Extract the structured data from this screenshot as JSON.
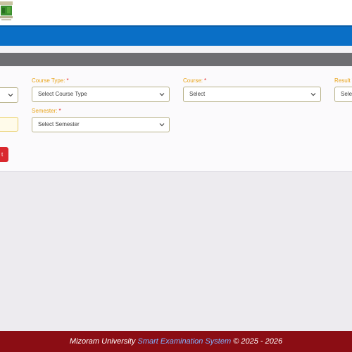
{
  "form": {
    "course_type": {
      "label": "Course Type:",
      "required_mark": "*",
      "placeholder": "Select Course Type"
    },
    "course": {
      "label": "Course:",
      "required_mark": "*",
      "placeholder": "Select"
    },
    "result_type": {
      "label": "Result T",
      "placeholder": "Selec"
    },
    "semester": {
      "label": "Semester:",
      "required_mark": "*",
      "placeholder": "Select Semester"
    },
    "submit_label": "t"
  },
  "footer": {
    "university": "Mizoram University ",
    "system_name": "Smart Examination System",
    "copyright": " © 2025 - 2026"
  },
  "colors": {
    "nav_blue": "#0a6fc6",
    "label_orange": "#e8a317",
    "required_red": "#e3262a",
    "footer_maroon": "#8b0d14",
    "accent_blue": "#7fb2ff"
  }
}
